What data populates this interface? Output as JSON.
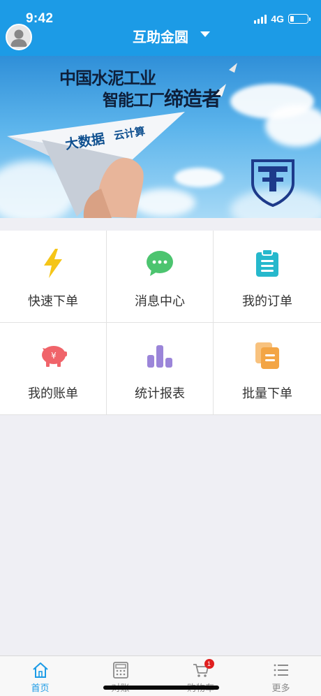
{
  "status_bar": {
    "time": "9:42",
    "network": "4G"
  },
  "header": {
    "title": "互助金圆"
  },
  "banner": {
    "line1": "中国水泥工业",
    "line2_prefix": "智能工厂",
    "line2_emphasis": "缔造者",
    "tag1": "大数据",
    "tag2": "云计算"
  },
  "menu": [
    {
      "label": "快速下单",
      "icon": "lightning-icon",
      "color": "#f5c518"
    },
    {
      "label": "消息中心",
      "icon": "chat-bubble-icon",
      "color": "#4cc46f"
    },
    {
      "label": "我的订单",
      "icon": "clipboard-icon",
      "color": "#26b8cc"
    },
    {
      "label": "我的账单",
      "icon": "piggy-bank-icon",
      "color": "#f0646a"
    },
    {
      "label": "统计报表",
      "icon": "bar-chart-icon",
      "color": "#9b85d9"
    },
    {
      "label": "批量下单",
      "icon": "documents-icon",
      "color": "#f3a545"
    }
  ],
  "tabbar": {
    "items": [
      {
        "label": "首页",
        "icon": "home-icon",
        "active": true
      },
      {
        "label": "对账",
        "icon": "calculator-icon",
        "active": false
      },
      {
        "label": "购物车",
        "icon": "cart-icon",
        "active": false,
        "badge": "1"
      },
      {
        "label": "更多",
        "icon": "list-icon",
        "active": false
      }
    ]
  },
  "colors": {
    "primary": "#1c9be6",
    "background": "#efeff4"
  }
}
